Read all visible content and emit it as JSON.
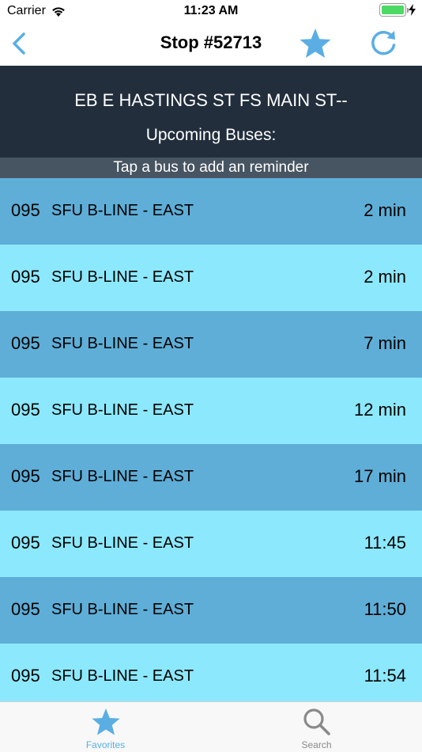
{
  "status_bar": {
    "carrier": "Carrier",
    "time": "11:23 AM",
    "battery_level": 1.0
  },
  "nav": {
    "title": "Stop #52713",
    "back_icon": "chevron-left-icon",
    "favorite_icon": "star-icon",
    "refresh_icon": "refresh-icon",
    "accent_color": "#5aaee4"
  },
  "stop": {
    "name": "EB E HASTINGS ST FS MAIN ST--",
    "upcoming_label": "Upcoming Buses:",
    "hint": "Tap a bus to add an reminder"
  },
  "buses": [
    {
      "route": "095",
      "destination": "SFU B-LINE - EAST",
      "time": "2 min"
    },
    {
      "route": "095",
      "destination": "SFU B-LINE - EAST",
      "time": "2 min"
    },
    {
      "route": "095",
      "destination": "SFU B-LINE - EAST",
      "time": "7 min"
    },
    {
      "route": "095",
      "destination": "SFU B-LINE - EAST",
      "time": "12 min"
    },
    {
      "route": "095",
      "destination": "SFU B-LINE - EAST",
      "time": "17 min"
    },
    {
      "route": "095",
      "destination": "SFU B-LINE - EAST",
      "time": "11:45"
    },
    {
      "route": "095",
      "destination": "SFU B-LINE - EAST",
      "time": "11:50"
    },
    {
      "route": "095",
      "destination": "SFU B-LINE - EAST",
      "time": "11:54"
    }
  ],
  "row_colors": {
    "dark": "#5eaed7",
    "light": "#8ce8fc"
  },
  "tabs": [
    {
      "label": "Favorites",
      "icon": "star-icon",
      "active": true
    },
    {
      "label": "Search",
      "icon": "search-icon",
      "active": false
    }
  ]
}
